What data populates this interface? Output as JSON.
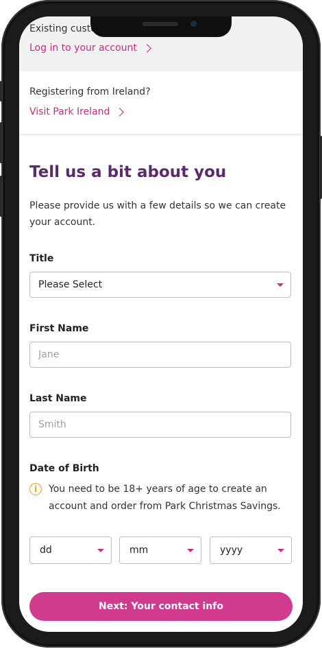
{
  "existing": {
    "label": "Existing custo",
    "login_link": "Log in to your account"
  },
  "ireland": {
    "label": "Registering from Ireland?",
    "visit_link": "Visit Park Ireland"
  },
  "form": {
    "heading": "Tell us a bit about you",
    "intro": "Please provide us with a few details so we can create your account.",
    "title_label": "Title",
    "title_value": "Please Select",
    "first_name_label": "First Name",
    "first_name_placeholder": "Jane",
    "last_name_label": "Last Name",
    "last_name_placeholder": "Smith",
    "dob_label": "Date of Birth",
    "dob_notice": "You need to be 18+ years of age to create an account and order from Park Christmas Savings.",
    "dob_day": "dd",
    "dob_month": "mm",
    "dob_year": "yyyy",
    "next_button": "Next: Your contact info"
  },
  "colors": {
    "accent": "#c42c7d",
    "button": "#d03a8f",
    "heading": "#5a2a6b",
    "info": "#e8a81e"
  },
  "icons": {
    "chevron": "chevron-right-icon",
    "caret": "caret-down-icon",
    "info": "info-icon"
  }
}
